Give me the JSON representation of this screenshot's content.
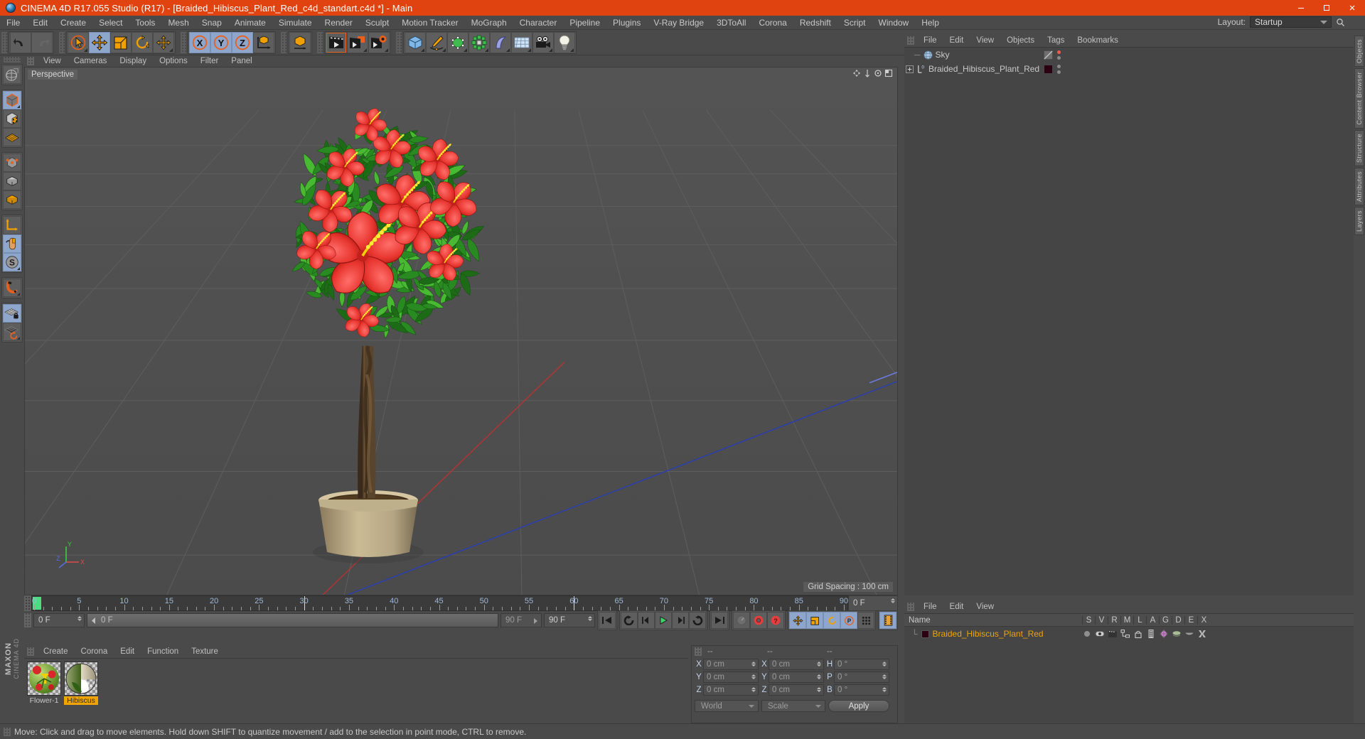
{
  "titlebar": {
    "text": "CINEMA 4D R17.055 Studio (R17) - [Braided_Hibiscus_Plant_Red_c4d_standart.c4d *] - Main",
    "minimize": "minimize-icon",
    "maximize": "maximize-icon",
    "close": "close-icon",
    "accent": "#e0430f"
  },
  "menubar": {
    "items": [
      "File",
      "Edit",
      "Create",
      "Select",
      "Tools",
      "Mesh",
      "Snap",
      "Animate",
      "Simulate",
      "Render",
      "Sculpt",
      "Motion Tracker",
      "MoGraph",
      "Character",
      "Pipeline",
      "Plugins",
      "V-Ray Bridge",
      "3DToAll",
      "Corona",
      "Redshift",
      "Script",
      "Window",
      "Help"
    ],
    "layout_label": "Layout:",
    "layout_value": "Startup"
  },
  "toolbar": {
    "groups": [
      {
        "name": "undo-redo",
        "buttons": [
          {
            "name": "undo-button",
            "icon": "undo-arrow-icon",
            "selected": false
          },
          {
            "name": "redo-button",
            "icon": "redo-arrow-icon",
            "selected": false,
            "dim": true
          }
        ]
      },
      {
        "name": "tools",
        "buttons": [
          {
            "name": "live-selection-tool",
            "icon": "cursor-circle-icon",
            "selected": false,
            "corner": true
          },
          {
            "name": "move-tool",
            "icon": "move-arrows-icon",
            "selected": true
          },
          {
            "name": "scale-tool",
            "icon": "scale-square-icon",
            "selected": false
          },
          {
            "name": "rotate-tool",
            "icon": "rotate-circle-icon",
            "selected": false
          },
          {
            "name": "move-duplicate-tool",
            "icon": "move-arrows-icon",
            "selected": false,
            "corner": true
          }
        ]
      },
      {
        "name": "axis-locks",
        "buttons": [
          {
            "name": "x-axis-lock",
            "icon": "x-axis-icon",
            "selected": true
          },
          {
            "name": "y-axis-lock",
            "icon": "y-axis-icon",
            "selected": true
          },
          {
            "name": "z-axis-lock",
            "icon": "z-axis-icon",
            "selected": true
          },
          {
            "name": "world-object-axis-toggle",
            "icon": "world-axis-cube-icon",
            "selected": false
          }
        ]
      },
      {
        "name": "coordinate-system",
        "buttons": [
          {
            "name": "coordinate-system-toggle",
            "icon": "orange-cube-axis-icon",
            "selected": false
          }
        ]
      },
      {
        "name": "render",
        "buttons": [
          {
            "name": "render-view-button",
            "icon": "clapper-play-icon",
            "selected": false,
            "highlight": true
          },
          {
            "name": "render-to-picture-viewer-button",
            "icon": "clapper-picture-icon",
            "selected": false,
            "corner": true
          },
          {
            "name": "render-settings-button",
            "icon": "clapper-gear-icon",
            "selected": false,
            "corner": true
          }
        ]
      },
      {
        "name": "create-objects",
        "buttons": [
          {
            "name": "add-cube-object-button",
            "icon": "blue-cube-icon",
            "selected": false,
            "corner": true
          },
          {
            "name": "add-spline-button",
            "icon": "pen-spline-icon",
            "selected": false,
            "corner": true
          },
          {
            "name": "add-generator-button",
            "icon": "green-cube-generator-icon",
            "selected": false,
            "corner": true
          },
          {
            "name": "add-mograph-button",
            "icon": "green-cluster-icon",
            "selected": false,
            "corner": true
          },
          {
            "name": "add-deformer-button",
            "icon": "purple-bend-icon",
            "selected": false,
            "corner": true
          },
          {
            "name": "add-environment-button",
            "icon": "grid-floor-icon",
            "selected": false,
            "corner": true
          },
          {
            "name": "add-camera-button",
            "icon": "camera-icon",
            "selected": false,
            "corner": true
          },
          {
            "name": "add-light-button",
            "icon": "light-bulb-icon",
            "selected": false,
            "corner": true
          }
        ]
      }
    ]
  },
  "left_palette": {
    "groups": [
      {
        "name": "texture-axis",
        "buttons": [
          {
            "name": "texture-axis-tool",
            "icon": "globe-wire-icon",
            "selected": false
          }
        ]
      },
      {
        "name": "modes-a",
        "buttons": [
          {
            "name": "model-mode-button",
            "icon": "model-cube-icon",
            "selected": true,
            "corner": true
          },
          {
            "name": "texture-mode-button",
            "icon": "checker-cube-icon",
            "selected": false
          },
          {
            "name": "workplane-mode-button",
            "icon": "orange-grid-icon",
            "selected": false
          }
        ]
      },
      {
        "name": "modes-b",
        "buttons": [
          {
            "name": "point-mode-button",
            "icon": "point-cube-icon",
            "selected": false
          },
          {
            "name": "edge-mode-button",
            "icon": "edge-cube-icon",
            "selected": false
          },
          {
            "name": "polygon-mode-button",
            "icon": "polygon-cube-icon",
            "selected": false
          }
        ]
      },
      {
        "name": "axis-snap",
        "buttons": [
          {
            "name": "enable-axis-modification-button",
            "icon": "axis-l-icon",
            "selected": false
          },
          {
            "name": "enable-snapping-button",
            "icon": "mouse-icon",
            "selected": true
          },
          {
            "name": "soft-selection-button",
            "icon": "s-sphere-icon",
            "selected": true,
            "corner": true
          }
        ]
      },
      {
        "name": "magnet",
        "buttons": [
          {
            "name": "magnet-tool",
            "icon": "magnet-icon",
            "selected": false,
            "corner": true
          }
        ]
      },
      {
        "name": "workplane",
        "buttons": [
          {
            "name": "lock-workplane-button",
            "icon": "grid-lock-icon",
            "selected": true
          },
          {
            "name": "planar-workplane-button",
            "icon": "grid-rotate-icon",
            "selected": false,
            "corner": true
          }
        ]
      }
    ],
    "brand_top": "MAXON",
    "brand_bottom": "CINEMA 4D"
  },
  "viewport": {
    "menu": [
      "View",
      "Cameras",
      "Display",
      "Options",
      "Filter",
      "Panel"
    ],
    "label": "Perspective",
    "grid_spacing": "Grid Spacing : 100 cm",
    "axis_gizmo": {
      "x": "X",
      "y": "Y",
      "z": "Z"
    },
    "background": "#4f4f4f",
    "corner_icons": [
      "pan-view-icon",
      "zoom-view-icon",
      "rotate-view-icon",
      "maximize-view-icon"
    ]
  },
  "timeline": {
    "ticks": [
      0,
      5,
      10,
      15,
      20,
      25,
      30,
      35,
      40,
      45,
      50,
      55,
      60,
      65,
      70,
      75,
      80,
      85,
      90
    ],
    "current_frame_label": "0 F",
    "start_frame": "0 F",
    "end_frame": "90 F",
    "scrub_value": "0 F",
    "preview_end": "90 F",
    "right_frame_field": "0 F"
  },
  "transport": {
    "buttons": [
      {
        "name": "go-to-start-button",
        "icon": "skip-start-icon"
      },
      {
        "name": "go-to-previous-key-button",
        "icon": "prev-key-icon"
      },
      {
        "name": "step-back-button",
        "icon": "step-back-icon"
      },
      {
        "name": "play-button",
        "icon": "play-icon"
      },
      {
        "name": "step-forward-button",
        "icon": "step-forward-icon"
      },
      {
        "name": "go-to-next-key-button",
        "icon": "next-key-icon"
      },
      {
        "name": "go-to-end-button",
        "icon": "skip-end-icon"
      }
    ],
    "record_buttons": [
      {
        "name": "autokeying-button",
        "icon": "autokey-icon",
        "selected": false
      },
      {
        "name": "record-active-objects-button",
        "icon": "record-circle-icon",
        "selected": false
      },
      {
        "name": "keyframe-selection-button",
        "icon": "question-circle-icon",
        "selected": false
      }
    ],
    "pqs_buttons": [
      {
        "name": "position-keyframe-toggle",
        "icon": "move-arrows-icon",
        "selected": true
      },
      {
        "name": "scale-keyframe-toggle",
        "icon": "scale-square-icon",
        "selected": true
      },
      {
        "name": "rotation-keyframe-toggle",
        "icon": "rotate-circle-icon",
        "selected": true
      },
      {
        "name": "parameter-keyframe-toggle",
        "icon": "p-circle-icon",
        "selected": true
      },
      {
        "name": "point-level-animation-toggle",
        "icon": "dots-grid-icon",
        "selected": false
      }
    ],
    "film_button": {
      "name": "film-strip-button",
      "icon": "film-strip-icon",
      "selected": true
    }
  },
  "object_manager": {
    "menu": [
      "File",
      "Edit",
      "View",
      "Objects",
      "Tags",
      "Bookmarks"
    ],
    "rows": [
      {
        "name": "Sky",
        "icon": "sky-sphere-icon",
        "tag_color": "#6f6f6f",
        "tag_icon": "sky-tag-icon",
        "dot_top": "#ef5b4c",
        "dot_bottom": "#8a8a8a",
        "indent": 12,
        "expandable": false
      },
      {
        "name": "Braided_Hibiscus_Plant_Red",
        "icon": "null-object-icon",
        "tag_color": "#2b0010",
        "tag_icon": "material-tag-icon",
        "dot_top": "#8a8a8a",
        "dot_bottom": "#8a8a8a",
        "indent": 0,
        "expandable": true,
        "layer_badge": "0"
      }
    ]
  },
  "attribute_manager": {
    "menu": [
      "File",
      "Edit",
      "View"
    ],
    "columns": [
      "Name",
      "S",
      "V",
      "R",
      "M",
      "L",
      "A",
      "G",
      "D",
      "E",
      "X"
    ],
    "rows": [
      {
        "name": "Braided_Hibiscus_Plant_Red",
        "color": "#f0a400",
        "swatch": "#2b0010",
        "tags": [
          "dot-icon",
          "visibility-eye-icon",
          "render-clapper-icon",
          "hierarchy-icon",
          "lock-icon",
          "layer-bars-icon",
          "deform-icon",
          "shade-icon",
          "cap-icon",
          "xref-icon"
        ]
      }
    ]
  },
  "material_manager": {
    "menu": [
      "Create",
      "Corona",
      "Edit",
      "Function",
      "Texture"
    ],
    "materials": [
      {
        "name": "Flower-1",
        "selected": false,
        "colors": [
          "#8cc63f",
          "#d6252a",
          "#f0d000"
        ]
      },
      {
        "name": "Hibiscus",
        "selected": true,
        "colors": [
          "#4f7a28",
          "#cbbfa0",
          "#ffffff"
        ]
      }
    ]
  },
  "coordinate_manager": {
    "headers": [
      "--",
      "--",
      "--"
    ],
    "rows": [
      {
        "pos_label": "X",
        "pos_value": "0 cm",
        "size_label": "X",
        "size_value": "0 cm",
        "rot_label": "H",
        "rot_value": "0 °"
      },
      {
        "pos_label": "Y",
        "pos_value": "0 cm",
        "size_label": "Y",
        "size_value": "0 cm",
        "rot_label": "P",
        "rot_value": "0 °"
      },
      {
        "pos_label": "Z",
        "pos_value": "0 cm",
        "size_label": "Z",
        "size_value": "0 cm",
        "rot_label": "B",
        "rot_value": "0 °"
      }
    ],
    "system_value": "World",
    "mode_value": "Scale",
    "apply_label": "Apply"
  },
  "right_dock": {
    "tabs": [
      "Objects",
      "Content Browser",
      "Structure",
      "Attributes",
      "Layers"
    ]
  },
  "statusbar": {
    "text": "Move: Click and drag to move elements. Hold down SHIFT to quantize movement / add to the selection in point mode, CTRL to remove."
  }
}
